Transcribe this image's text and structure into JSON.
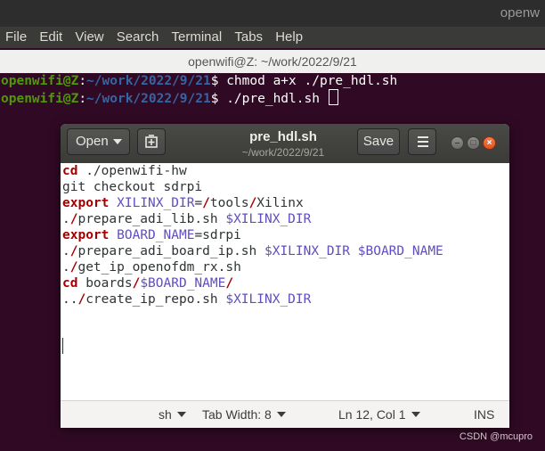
{
  "terminal": {
    "app_name": "openw",
    "menu": [
      "File",
      "Edit",
      "View",
      "Search",
      "Terminal",
      "Tabs",
      "Help"
    ],
    "tab_title": "openwifi@Z: ~/work/2022/9/21",
    "lines": [
      {
        "user": "openwifi@Z",
        "sep": ":",
        "path": "~/work/2022/9/21",
        "sigil": "$ ",
        "command": "chmod a+x ./pre_hdl.sh"
      },
      {
        "user": "openwifi@Z",
        "sep": ":",
        "path": "~/work/2022/9/21",
        "sigil": "$ ",
        "command": "./pre_hdl.sh "
      }
    ]
  },
  "gedit": {
    "open_label": "Open",
    "save_label": "Save",
    "title": "pre_hdl.sh",
    "subtitle": "~/work/2022/9/21",
    "code": [
      [
        {
          "t": "cd",
          "c": "kw"
        },
        {
          "t": " ./openwifi-hw",
          "c": ""
        }
      ],
      [
        {
          "t": "git checkout sdrpi",
          "c": ""
        }
      ],
      [
        {
          "t": "export",
          "c": "kw"
        },
        {
          "t": " ",
          "c": ""
        },
        {
          "t": "XILINX_DIR",
          "c": "var"
        },
        {
          "t": "=",
          "c": ""
        },
        {
          "t": "/",
          "c": "sym"
        },
        {
          "t": "tools",
          "c": ""
        },
        {
          "t": "/",
          "c": "sym"
        },
        {
          "t": "Xilinx",
          "c": ""
        }
      ],
      [
        {
          "t": ".",
          "c": ""
        },
        {
          "t": "/",
          "c": "sym"
        },
        {
          "t": "prepare_adi_lib.sh ",
          "c": ""
        },
        {
          "t": "$XILINX_DIR",
          "c": "var"
        }
      ],
      [
        {
          "t": "export",
          "c": "kw"
        },
        {
          "t": " ",
          "c": ""
        },
        {
          "t": "BOARD_NAME",
          "c": "var"
        },
        {
          "t": "=sdrpi",
          "c": ""
        }
      ],
      [
        {
          "t": ".",
          "c": ""
        },
        {
          "t": "/",
          "c": "sym"
        },
        {
          "t": "prepare_adi_board_ip.sh ",
          "c": ""
        },
        {
          "t": "$XILINX_DIR",
          "c": "var"
        },
        {
          "t": " ",
          "c": ""
        },
        {
          "t": "$BOARD_NAME",
          "c": "var"
        }
      ],
      [
        {
          "t": ".",
          "c": ""
        },
        {
          "t": "/",
          "c": "sym"
        },
        {
          "t": "get_ip_openofdm_rx.sh",
          "c": ""
        }
      ],
      [
        {
          "t": "cd",
          "c": "kw"
        },
        {
          "t": " boards",
          "c": ""
        },
        {
          "t": "/",
          "c": "sym"
        },
        {
          "t": "$BOARD_NAME",
          "c": "var"
        },
        {
          "t": "/",
          "c": "sym"
        }
      ],
      [
        {
          "t": "..",
          "c": ""
        },
        {
          "t": "/",
          "c": "sym"
        },
        {
          "t": "create_ip_repo.sh ",
          "c": ""
        },
        {
          "t": "$XILINX_DIR",
          "c": "var"
        }
      ]
    ],
    "status": {
      "language": "sh",
      "tab_width": "Tab Width: 8",
      "position": "Ln 12, Col 1",
      "mode": "INS"
    }
  },
  "watermark": "CSDN @mcupro",
  "colors": {
    "terminal_bg": "#300a24",
    "prompt_user": "#4e9a06",
    "prompt_path": "#3465a4",
    "keyword": "#a40000",
    "variable": "#5e4ec2",
    "close_button": "#e05420"
  }
}
